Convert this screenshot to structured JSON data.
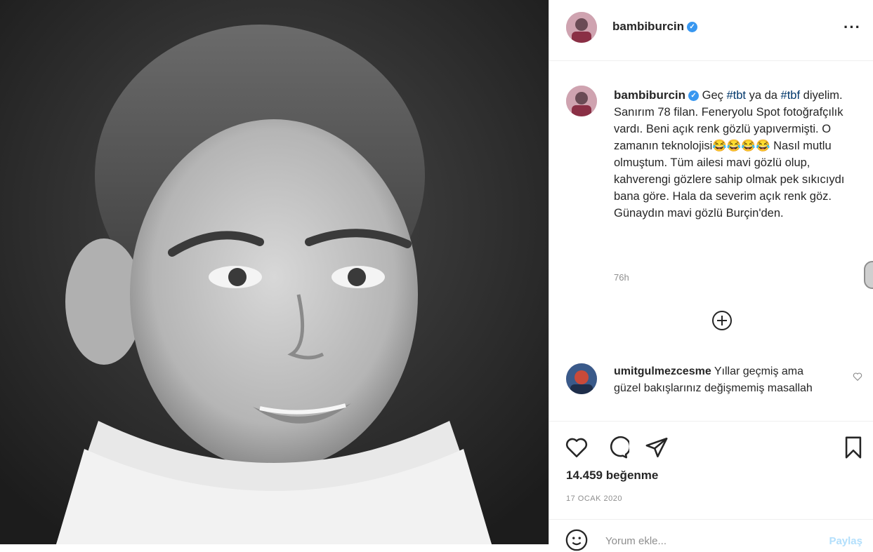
{
  "post": {
    "username": "bambiburcin",
    "verified": true,
    "more_icon": "more-horizontal-icon",
    "caption_parts": {
      "p1": "Geç ",
      "tag1": "#tbt",
      "p2": " ya da ",
      "tag2": "#tbf",
      "p3": " diyelim. Sanırım 78 filan. Feneryolu Spot fotoğrafçılık vardı. Beni açık renk gözlü yapıvermişti. O zamanın teknolojisi",
      "emojis": "😂😂😂😂",
      "p4": " Nasıl mutlu olmuştum. Tüm ailesi mavi gözlü olup, kahverengi gözlere sahip olmak pek sıkıcıydı bana göre. Hala da severim açık renk göz. Günaydın mavi gözlü Burçin'den."
    },
    "time_ago": "76h",
    "load_more_icon": "plus-circle-icon"
  },
  "comments": [
    {
      "username": "umitgulmezcesme",
      "text": "Yıllar geçmiş ama güzel bakışlarınız değişmemiş masallah"
    }
  ],
  "actions": {
    "icons": [
      "heart-icon",
      "comment-icon",
      "share-icon",
      "bookmark-icon"
    ]
  },
  "likes": "14.459 beğenme",
  "date": "17 OCAK 2020",
  "add_comment": {
    "placeholder": "Yorum ekle...",
    "post_label": "Paylaş"
  },
  "colors": {
    "verified": "#3897f0",
    "hashtag": "#00376b",
    "muted": "#8e8e8e"
  }
}
